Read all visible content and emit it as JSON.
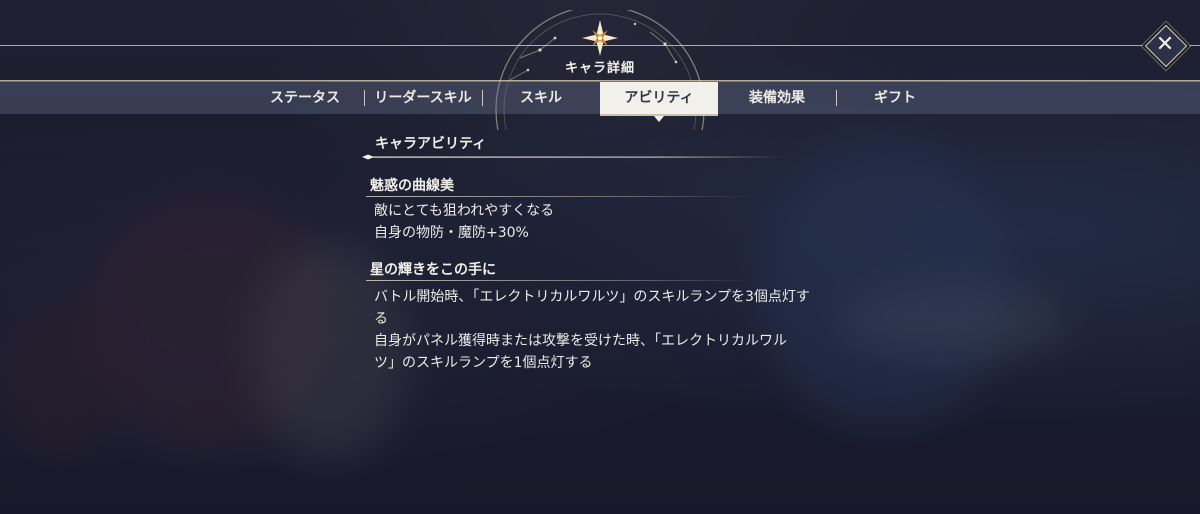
{
  "header": {
    "title": "キャラ詳細",
    "close_label": "✕"
  },
  "tabs": [
    {
      "label": "ステータス",
      "active": false
    },
    {
      "label": "リーダースキル",
      "active": false
    },
    {
      "label": "スキル",
      "active": false
    },
    {
      "label": "アビリティ",
      "active": true
    },
    {
      "label": "装備効果",
      "active": false
    },
    {
      "label": "ギフト",
      "active": false
    }
  ],
  "content": {
    "section_title": "キャラアビリティ",
    "abilities": [
      {
        "name": "魅惑の曲線美",
        "lines": [
          "敵にとても狙われやすくなる",
          "自身の物防・魔防+30%"
        ]
      },
      {
        "name": "星の輝きをこの手に",
        "lines": [
          "バトル開始時、「エレクトリカルワルツ」のスキルランプを3個点灯す",
          "る",
          "自身がパネル獲得時または攻撃を受けた時、「エレクトリカルワル",
          "ツ」のスキルランプを1個点灯する"
        ]
      }
    ]
  },
  "colors": {
    "accent_gold": "#d8cfae",
    "active_tab_bg": "#f2f0ea",
    "text_light": "#f1efe8"
  },
  "icons": {
    "emblem": "compass-star-icon",
    "close": "close-icon"
  }
}
